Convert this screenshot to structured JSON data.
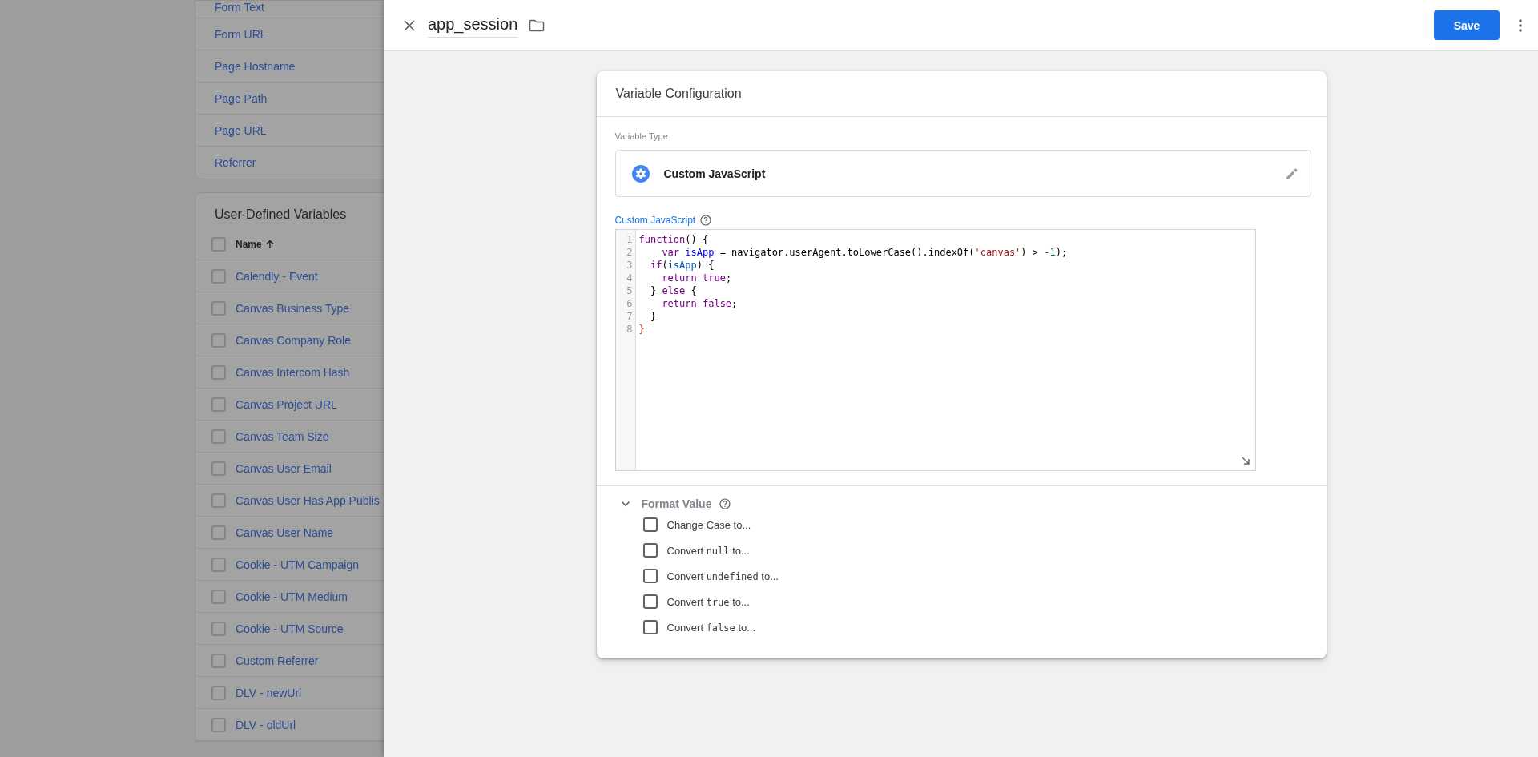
{
  "background_page": {
    "builtin_variables": [
      "Form Text",
      "Form URL",
      "Page Hostname",
      "Page Path",
      "Page URL",
      "Referrer"
    ],
    "user_defined_variables": {
      "title": "User-Defined Variables",
      "name_column": "Name",
      "header_checked": false,
      "rows": [
        {
          "name": "Calendly - Event",
          "checked": false
        },
        {
          "name": "Canvas Business Type",
          "checked": false
        },
        {
          "name": "Canvas Company Role",
          "checked": false
        },
        {
          "name": "Canvas Intercom Hash",
          "checked": false
        },
        {
          "name": "Canvas Project URL",
          "checked": false
        },
        {
          "name": "Canvas Team Size",
          "checked": false
        },
        {
          "name": "Canvas User Email",
          "checked": false
        },
        {
          "name": "Canvas User Has App Publis",
          "checked": false
        },
        {
          "name": "Canvas User Name",
          "checked": false
        },
        {
          "name": "Cookie - UTM Campaign",
          "checked": false
        },
        {
          "name": "Cookie - UTM Medium",
          "checked": false
        },
        {
          "name": "Cookie - UTM Source",
          "checked": false
        },
        {
          "name": "Custom Referrer",
          "checked": false
        },
        {
          "name": "DLV - newUrl",
          "checked": false
        },
        {
          "name": "DLV - oldUrl",
          "checked": false
        }
      ]
    }
  },
  "editor": {
    "title": "app_session",
    "save_label": "Save",
    "card": {
      "title": "Variable Configuration",
      "type_label": "Variable Type",
      "type_name": "Custom JavaScript",
      "code_label": "Custom JavaScript",
      "code_lines": [
        {
          "number": "1",
          "tokens": [
            {
              "text": "function",
              "kind": "keyword"
            },
            {
              "text": "() {",
              "kind": "plain"
            }
          ]
        },
        {
          "number": "2",
          "tokens": [
            {
              "text": "    var",
              "kind": "keyword"
            },
            {
              "text": " isApp",
              "kind": "def"
            },
            {
              "text": " = navigator.userAgent.toLowerCase().indexOf(",
              "kind": "plain"
            },
            {
              "text": "'canvas'",
              "kind": "string"
            },
            {
              "text": ") > ",
              "kind": "plain"
            },
            {
              "text": "-1",
              "kind": "number"
            },
            {
              "text": ");",
              "kind": "plain"
            }
          ]
        },
        {
          "number": "3",
          "tokens": [
            {
              "text": "  if",
              "kind": "keyword"
            },
            {
              "text": "(",
              "kind": "plain"
            },
            {
              "text": "isApp",
              "kind": "variable"
            },
            {
              "text": ") {",
              "kind": "plain"
            }
          ]
        },
        {
          "number": "4",
          "tokens": [
            {
              "text": "    return",
              "kind": "keyword"
            },
            {
              "text": " true",
              "kind": "atom"
            },
            {
              "text": ";",
              "kind": "plain"
            }
          ]
        },
        {
          "number": "5",
          "tokens": [
            {
              "text": "  } ",
              "kind": "plain"
            },
            {
              "text": "else",
              "kind": "keyword"
            },
            {
              "text": " {",
              "kind": "plain"
            }
          ]
        },
        {
          "number": "6",
          "tokens": [
            {
              "text": "    return",
              "kind": "keyword"
            },
            {
              "text": " false",
              "kind": "atom"
            },
            {
              "text": ";",
              "kind": "plain"
            }
          ]
        },
        {
          "number": "7",
          "tokens": [
            {
              "text": "  }",
              "kind": "plain"
            }
          ]
        },
        {
          "number": "8",
          "tokens": [
            {
              "text": "}",
              "kind": "bracket"
            }
          ]
        }
      ]
    },
    "format_value": {
      "title": "Format Value",
      "expanded": true,
      "options": [
        {
          "parts": [
            {
              "text": "Change Case to...",
              "kind": "plain"
            }
          ],
          "checked": false
        },
        {
          "parts": [
            {
              "text": "Convert ",
              "kind": "plain"
            },
            {
              "text": "null",
              "kind": "code"
            },
            {
              "text": " to...",
              "kind": "plain"
            }
          ],
          "checked": false
        },
        {
          "parts": [
            {
              "text": "Convert ",
              "kind": "plain"
            },
            {
              "text": "undefined",
              "kind": "code"
            },
            {
              "text": " to...",
              "kind": "plain"
            }
          ],
          "checked": false
        },
        {
          "parts": [
            {
              "text": "Convert ",
              "kind": "plain"
            },
            {
              "text": "true",
              "kind": "code"
            },
            {
              "text": " to...",
              "kind": "plain"
            }
          ],
          "checked": false
        },
        {
          "parts": [
            {
              "text": "Convert ",
              "kind": "plain"
            },
            {
              "text": "false",
              "kind": "code"
            },
            {
              "text": " to...",
              "kind": "plain"
            }
          ],
          "checked": false
        }
      ]
    }
  }
}
